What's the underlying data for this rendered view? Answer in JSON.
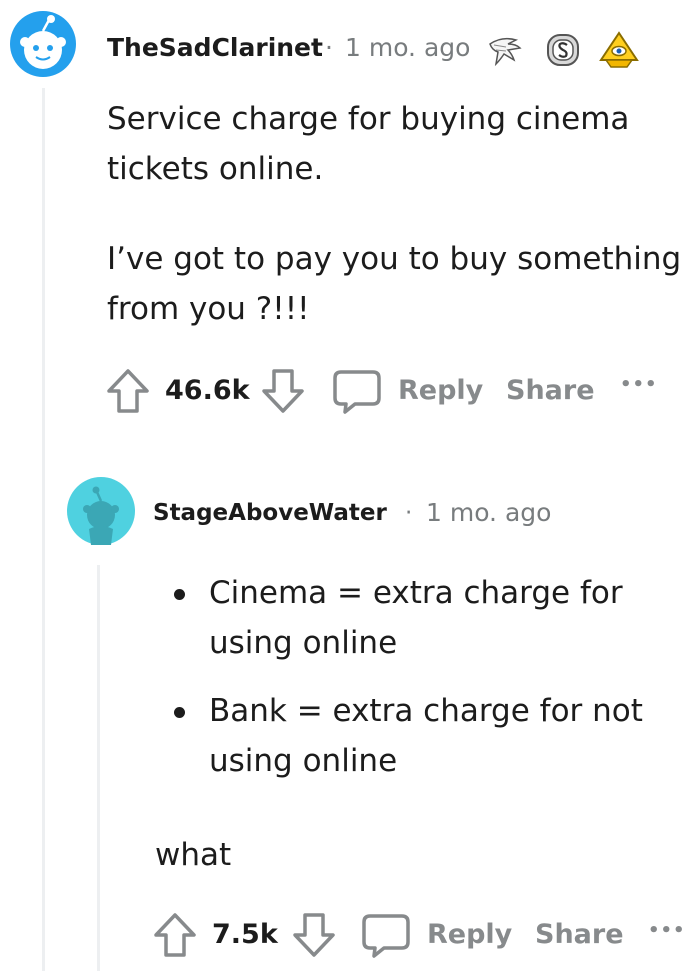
{
  "comment1": {
    "username": "TheSadClarinet",
    "separator": "·",
    "time": "1 mo. ago",
    "paragraphs": [
      "Service charge for buying cinema tickets online.",
      "I’ve got to pay you to buy something from you ?!!!"
    ],
    "score": "46.6k",
    "reply_label": "Reply",
    "share_label": "Share",
    "more_label": "•••"
  },
  "comment2": {
    "username": "StageAboveWater",
    "separator": "·",
    "time": "1 mo. ago",
    "bullets": [
      "Cinema = extra charge for using online",
      "Bank = extra charge for not using online"
    ],
    "text": "what",
    "score": "7.5k",
    "reply_label": "Reply",
    "share_label": "Share",
    "more_label": "•••"
  },
  "colors": {
    "avatar1": "#24a0ed",
    "avatar2": "#4fd1e0",
    "action": "#878a8c",
    "thread_line": "#edeff1"
  }
}
